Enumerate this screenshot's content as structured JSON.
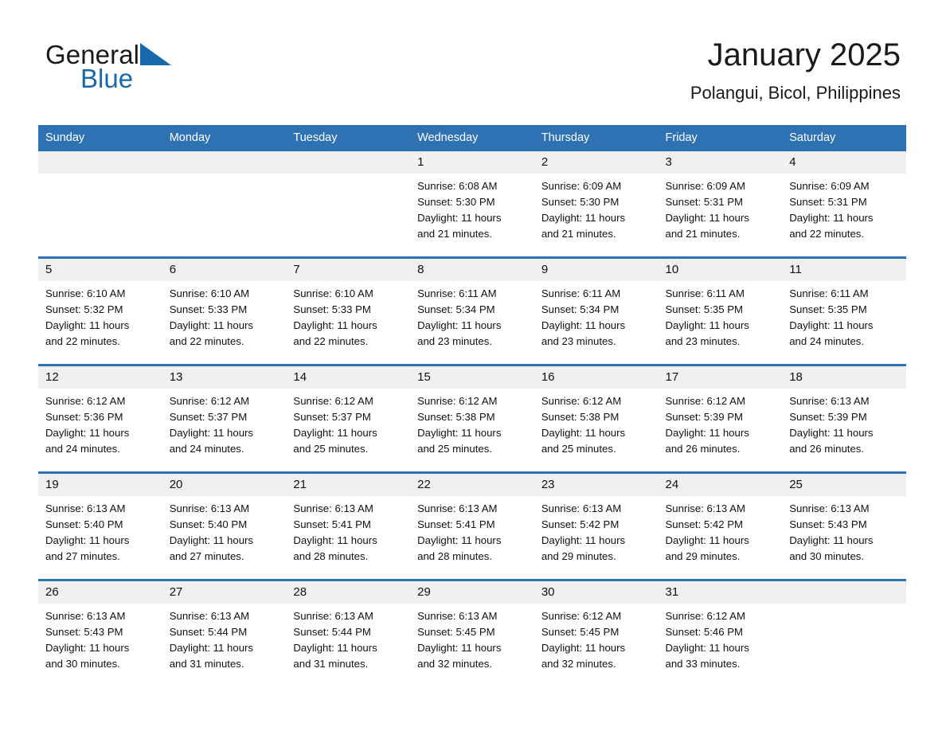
{
  "brand": {
    "name_part1": "General",
    "name_part2": "Blue",
    "triangle_color": "#1769ac"
  },
  "header": {
    "title": "January 2025",
    "subtitle": "Polangui, Bicol, Philippines"
  },
  "theme": {
    "header_blue": "#2f72b4",
    "daynum_gray": "#f0f0f0",
    "text_color": "#111111"
  },
  "weekday_headers": [
    "Sunday",
    "Monday",
    "Tuesday",
    "Wednesday",
    "Thursday",
    "Friday",
    "Saturday"
  ],
  "weeks": [
    [
      {
        "day": "",
        "blank": true,
        "sunrise": "",
        "sunset": "",
        "daylight_a": "",
        "daylight_b": ""
      },
      {
        "day": "",
        "blank": true,
        "sunrise": "",
        "sunset": "",
        "daylight_a": "",
        "daylight_b": ""
      },
      {
        "day": "",
        "blank": true,
        "sunrise": "",
        "sunset": "",
        "daylight_a": "",
        "daylight_b": ""
      },
      {
        "day": "1",
        "blank": false,
        "sunrise": "Sunrise: 6:08 AM",
        "sunset": "Sunset: 5:30 PM",
        "daylight_a": "Daylight: 11 hours",
        "daylight_b": "and 21 minutes."
      },
      {
        "day": "2",
        "blank": false,
        "sunrise": "Sunrise: 6:09 AM",
        "sunset": "Sunset: 5:30 PM",
        "daylight_a": "Daylight: 11 hours",
        "daylight_b": "and 21 minutes."
      },
      {
        "day": "3",
        "blank": false,
        "sunrise": "Sunrise: 6:09 AM",
        "sunset": "Sunset: 5:31 PM",
        "daylight_a": "Daylight: 11 hours",
        "daylight_b": "and 21 minutes."
      },
      {
        "day": "4",
        "blank": false,
        "sunrise": "Sunrise: 6:09 AM",
        "sunset": "Sunset: 5:31 PM",
        "daylight_a": "Daylight: 11 hours",
        "daylight_b": "and 22 minutes."
      }
    ],
    [
      {
        "day": "5",
        "blank": false,
        "sunrise": "Sunrise: 6:10 AM",
        "sunset": "Sunset: 5:32 PM",
        "daylight_a": "Daylight: 11 hours",
        "daylight_b": "and 22 minutes."
      },
      {
        "day": "6",
        "blank": false,
        "sunrise": "Sunrise: 6:10 AM",
        "sunset": "Sunset: 5:33 PM",
        "daylight_a": "Daylight: 11 hours",
        "daylight_b": "and 22 minutes."
      },
      {
        "day": "7",
        "blank": false,
        "sunrise": "Sunrise: 6:10 AM",
        "sunset": "Sunset: 5:33 PM",
        "daylight_a": "Daylight: 11 hours",
        "daylight_b": "and 22 minutes."
      },
      {
        "day": "8",
        "blank": false,
        "sunrise": "Sunrise: 6:11 AM",
        "sunset": "Sunset: 5:34 PM",
        "daylight_a": "Daylight: 11 hours",
        "daylight_b": "and 23 minutes."
      },
      {
        "day": "9",
        "blank": false,
        "sunrise": "Sunrise: 6:11 AM",
        "sunset": "Sunset: 5:34 PM",
        "daylight_a": "Daylight: 11 hours",
        "daylight_b": "and 23 minutes."
      },
      {
        "day": "10",
        "blank": false,
        "sunrise": "Sunrise: 6:11 AM",
        "sunset": "Sunset: 5:35 PM",
        "daylight_a": "Daylight: 11 hours",
        "daylight_b": "and 23 minutes."
      },
      {
        "day": "11",
        "blank": false,
        "sunrise": "Sunrise: 6:11 AM",
        "sunset": "Sunset: 5:35 PM",
        "daylight_a": "Daylight: 11 hours",
        "daylight_b": "and 24 minutes."
      }
    ],
    [
      {
        "day": "12",
        "blank": false,
        "sunrise": "Sunrise: 6:12 AM",
        "sunset": "Sunset: 5:36 PM",
        "daylight_a": "Daylight: 11 hours",
        "daylight_b": "and 24 minutes."
      },
      {
        "day": "13",
        "blank": false,
        "sunrise": "Sunrise: 6:12 AM",
        "sunset": "Sunset: 5:37 PM",
        "daylight_a": "Daylight: 11 hours",
        "daylight_b": "and 24 minutes."
      },
      {
        "day": "14",
        "blank": false,
        "sunrise": "Sunrise: 6:12 AM",
        "sunset": "Sunset: 5:37 PM",
        "daylight_a": "Daylight: 11 hours",
        "daylight_b": "and 25 minutes."
      },
      {
        "day": "15",
        "blank": false,
        "sunrise": "Sunrise: 6:12 AM",
        "sunset": "Sunset: 5:38 PM",
        "daylight_a": "Daylight: 11 hours",
        "daylight_b": "and 25 minutes."
      },
      {
        "day": "16",
        "blank": false,
        "sunrise": "Sunrise: 6:12 AM",
        "sunset": "Sunset: 5:38 PM",
        "daylight_a": "Daylight: 11 hours",
        "daylight_b": "and 25 minutes."
      },
      {
        "day": "17",
        "blank": false,
        "sunrise": "Sunrise: 6:12 AM",
        "sunset": "Sunset: 5:39 PM",
        "daylight_a": "Daylight: 11 hours",
        "daylight_b": "and 26 minutes."
      },
      {
        "day": "18",
        "blank": false,
        "sunrise": "Sunrise: 6:13 AM",
        "sunset": "Sunset: 5:39 PM",
        "daylight_a": "Daylight: 11 hours",
        "daylight_b": "and 26 minutes."
      }
    ],
    [
      {
        "day": "19",
        "blank": false,
        "sunrise": "Sunrise: 6:13 AM",
        "sunset": "Sunset: 5:40 PM",
        "daylight_a": "Daylight: 11 hours",
        "daylight_b": "and 27 minutes."
      },
      {
        "day": "20",
        "blank": false,
        "sunrise": "Sunrise: 6:13 AM",
        "sunset": "Sunset: 5:40 PM",
        "daylight_a": "Daylight: 11 hours",
        "daylight_b": "and 27 minutes."
      },
      {
        "day": "21",
        "blank": false,
        "sunrise": "Sunrise: 6:13 AM",
        "sunset": "Sunset: 5:41 PM",
        "daylight_a": "Daylight: 11 hours",
        "daylight_b": "and 28 minutes."
      },
      {
        "day": "22",
        "blank": false,
        "sunrise": "Sunrise: 6:13 AM",
        "sunset": "Sunset: 5:41 PM",
        "daylight_a": "Daylight: 11 hours",
        "daylight_b": "and 28 minutes."
      },
      {
        "day": "23",
        "blank": false,
        "sunrise": "Sunrise: 6:13 AM",
        "sunset": "Sunset: 5:42 PM",
        "daylight_a": "Daylight: 11 hours",
        "daylight_b": "and 29 minutes."
      },
      {
        "day": "24",
        "blank": false,
        "sunrise": "Sunrise: 6:13 AM",
        "sunset": "Sunset: 5:42 PM",
        "daylight_a": "Daylight: 11 hours",
        "daylight_b": "and 29 minutes."
      },
      {
        "day": "25",
        "blank": false,
        "sunrise": "Sunrise: 6:13 AM",
        "sunset": "Sunset: 5:43 PM",
        "daylight_a": "Daylight: 11 hours",
        "daylight_b": "and 30 minutes."
      }
    ],
    [
      {
        "day": "26",
        "blank": false,
        "sunrise": "Sunrise: 6:13 AM",
        "sunset": "Sunset: 5:43 PM",
        "daylight_a": "Daylight: 11 hours",
        "daylight_b": "and 30 minutes."
      },
      {
        "day": "27",
        "blank": false,
        "sunrise": "Sunrise: 6:13 AM",
        "sunset": "Sunset: 5:44 PM",
        "daylight_a": "Daylight: 11 hours",
        "daylight_b": "and 31 minutes."
      },
      {
        "day": "28",
        "blank": false,
        "sunrise": "Sunrise: 6:13 AM",
        "sunset": "Sunset: 5:44 PM",
        "daylight_a": "Daylight: 11 hours",
        "daylight_b": "and 31 minutes."
      },
      {
        "day": "29",
        "blank": false,
        "sunrise": "Sunrise: 6:13 AM",
        "sunset": "Sunset: 5:45 PM",
        "daylight_a": "Daylight: 11 hours",
        "daylight_b": "and 32 minutes."
      },
      {
        "day": "30",
        "blank": false,
        "sunrise": "Sunrise: 6:12 AM",
        "sunset": "Sunset: 5:45 PM",
        "daylight_a": "Daylight: 11 hours",
        "daylight_b": "and 32 minutes."
      },
      {
        "day": "31",
        "blank": false,
        "sunrise": "Sunrise: 6:12 AM",
        "sunset": "Sunset: 5:46 PM",
        "daylight_a": "Daylight: 11 hours",
        "daylight_b": "and 33 minutes."
      },
      {
        "day": "",
        "blank": true,
        "sunrise": "",
        "sunset": "",
        "daylight_a": "",
        "daylight_b": ""
      }
    ]
  ]
}
